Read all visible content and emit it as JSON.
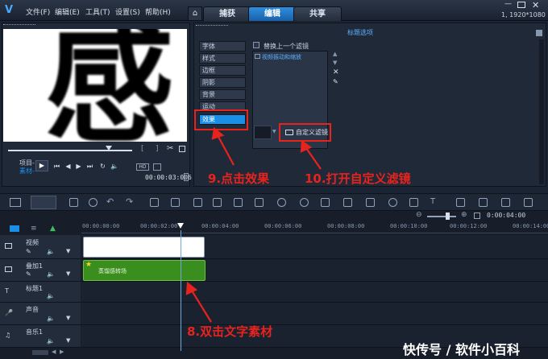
{
  "app": {
    "logo": "V",
    "resolution": "1, 1920*1080"
  },
  "menu": [
    {
      "label": "文件(F)"
    },
    {
      "label": "编辑(E)"
    },
    {
      "label": "工具(T)"
    },
    {
      "label": "设置(S)"
    },
    {
      "label": "帮助(H)"
    }
  ],
  "tabs": [
    {
      "label": "捕获"
    },
    {
      "label": "编辑"
    },
    {
      "label": "共享"
    }
  ],
  "preview": {
    "big_char": "感",
    "project_label": "项目-",
    "clip_label": "素材-",
    "timecode": "00:00:03:006",
    "hd_label": "HD"
  },
  "options": {
    "title": "标题选项",
    "side_tabs": [
      {
        "label": "字体"
      },
      {
        "label": "样式"
      },
      {
        "label": "边框"
      },
      {
        "label": "阴影"
      },
      {
        "label": "背景"
      },
      {
        "label": "运动"
      },
      {
        "label": "效果"
      }
    ],
    "replace_label": "替换上一个滤镜",
    "filter_item": "视频振动和缩放",
    "custom_filter_label": "自定义滤镜"
  },
  "timeline": {
    "zoom_timecode": "0:00:04:00",
    "ticks": [
      "00:00:00:00",
      "00:00:02:00",
      "00:00:04:00",
      "00:00:06:00",
      "00:00:08:00",
      "00:00:10:00",
      "00:00:12:00",
      "00:00:14:00"
    ],
    "tracks": [
      {
        "label": "视频"
      },
      {
        "label": "叠加1"
      },
      {
        "label": "标题1"
      },
      {
        "label": "声音"
      },
      {
        "label": "音乐1"
      }
    ],
    "overlay_clip_label": "蒸馏感转场"
  },
  "annotations": {
    "step8": "8.双击文字素材",
    "step9": "9.点击效果",
    "step10": "10.打开自定义滤镜"
  },
  "watermark": "快传号 / 软件小百科",
  "colors": {
    "accent": "#1a8fe8",
    "annotation": "#e8231e",
    "overlay_clip": "#3a8e1e"
  }
}
